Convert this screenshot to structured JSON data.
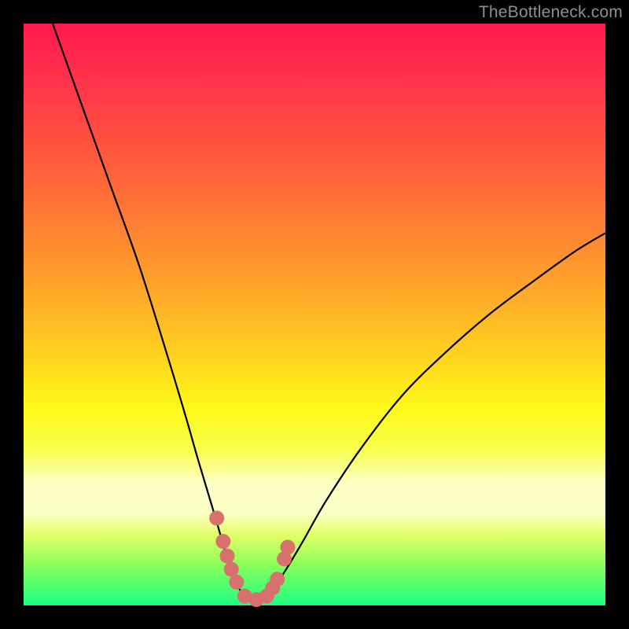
{
  "watermark": "TheBottleneck.com",
  "chart_data": {
    "type": "line",
    "title": "",
    "xlabel": "",
    "ylabel": "",
    "xlim": [
      0,
      100
    ],
    "ylim": [
      0,
      100
    ],
    "series": [
      {
        "name": "curve",
        "x": [
          5,
          10,
          15,
          20,
          25,
          28,
          30,
          33,
          35,
          36,
          37,
          38,
          39,
          40,
          41,
          42,
          43,
          45,
          48,
          52,
          58,
          65,
          72,
          80,
          88,
          95,
          100
        ],
        "values": [
          100,
          86,
          72,
          58,
          42,
          32,
          25,
          15,
          8,
          5,
          3,
          1.5,
          1,
          1,
          1,
          1.5,
          3,
          6,
          11,
          18,
          27,
          36,
          43,
          50,
          56,
          61,
          64
        ]
      }
    ],
    "markers": {
      "name": "highlighted-points",
      "color": "#d8716e",
      "x": [
        33.2,
        34.3,
        35.0,
        35.7,
        36.6,
        38.0,
        40.0,
        41.8,
        42.8,
        43.6,
        44.8,
        45.4
      ],
      "values": [
        15.0,
        11.0,
        8.5,
        6.2,
        4.0,
        1.6,
        1.0,
        1.6,
        3.0,
        4.5,
        8.0,
        10.0
      ]
    }
  },
  "colors": {
    "curve": "#000000",
    "marker": "#d8716e",
    "frame": "#000000"
  }
}
